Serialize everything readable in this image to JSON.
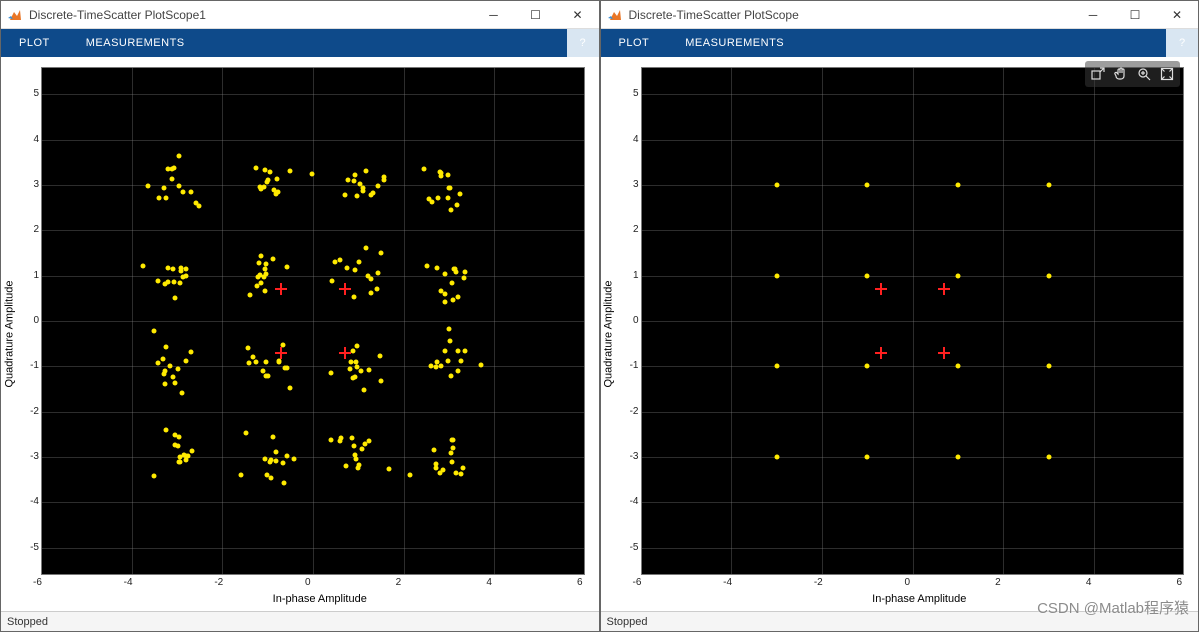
{
  "windows": [
    {
      "title": "Discrete-TimeScatter PlotScope1",
      "tabs": {
        "plot": "PLOT",
        "measurements": "MEASUREMENTS"
      },
      "status": "Stopped",
      "show_plot_toolbar": false
    },
    {
      "title": "Discrete-TimeScatter PlotScope",
      "tabs": {
        "plot": "PLOT",
        "measurements": "MEASUREMENTS"
      },
      "status": "Stopped",
      "show_plot_toolbar": true
    }
  ],
  "axes": {
    "xlabel": "In-phase Amplitude",
    "ylabel": "Quadrature Amplitude",
    "xticks": [
      -6,
      -4,
      -2,
      0,
      2,
      4,
      6
    ],
    "yticks": [
      -5,
      -4,
      -3,
      -2,
      -1,
      0,
      1,
      2,
      3,
      4,
      5
    ],
    "xlim": [
      -6,
      6
    ],
    "ylim": [
      -5.6,
      5.6
    ]
  },
  "watermark": "CSDN @Matlab程序猿",
  "chart_data": [
    {
      "type": "scatter",
      "title": "Discrete-TimeScatter PlotScope1",
      "xlabel": "In-phase Amplitude",
      "ylabel": "Quadrature Amplitude",
      "xlim": [
        -6,
        6
      ],
      "ylim": [
        -5.6,
        5.6
      ],
      "series": [
        {
          "name": "received-symbols",
          "color": "#ffea00",
          "marker": "dot",
          "cluster_centers_x": [
            -3,
            -1,
            1,
            3
          ],
          "cluster_centers_y": [
            -3,
            -1,
            1,
            3
          ],
          "noise_sigma": 0.28,
          "points_per_cluster": 14,
          "note": "16-QAM constellation with channel noise; ~224 scattered points around the 16 ideal centers"
        },
        {
          "name": "reference-markers",
          "color": "#ff2020",
          "marker": "plus",
          "x": [
            -0.7,
            0.7,
            -0.7,
            0.7
          ],
          "y": [
            0.7,
            0.7,
            -0.7,
            -0.7
          ]
        }
      ]
    },
    {
      "type": "scatter",
      "title": "Discrete-TimeScatter PlotScope",
      "xlabel": "In-phase Amplitude",
      "ylabel": "Quadrature Amplitude",
      "xlim": [
        -6,
        6
      ],
      "ylim": [
        -5.6,
        5.6
      ],
      "series": [
        {
          "name": "ideal-constellation",
          "color": "#ffea00",
          "marker": "dot",
          "x": [
            -3,
            -1,
            1,
            3,
            -3,
            -1,
            1,
            3,
            -3,
            -1,
            1,
            3,
            -3,
            -1,
            1,
            3
          ],
          "y": [
            3,
            3,
            3,
            3,
            1,
            1,
            1,
            1,
            -1,
            -1,
            -1,
            -1,
            -3,
            -3,
            -3,
            -3
          ]
        },
        {
          "name": "reference-markers",
          "color": "#ff2020",
          "marker": "plus",
          "x": [
            -0.7,
            0.7,
            -0.7,
            0.7
          ],
          "y": [
            0.7,
            0.7,
            -0.7,
            -0.7
          ]
        }
      ]
    }
  ]
}
